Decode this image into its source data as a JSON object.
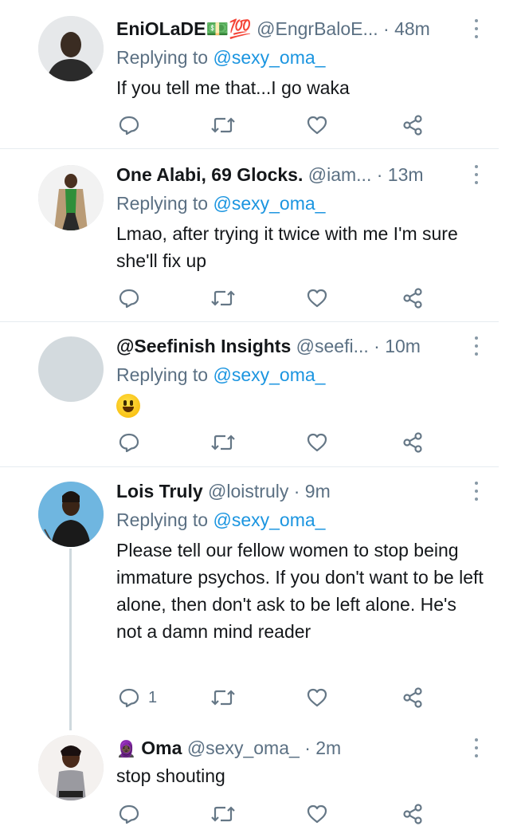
{
  "tweets": [
    {
      "name": "EniOLaDE💵💯",
      "handle": "@EngrBaloE...",
      "dot": "·",
      "time": "48m",
      "replying_prefix": "Replying to",
      "replying_to": "@sexy_oma_",
      "text": "If you tell me that...I go waka",
      "reply_count": ""
    },
    {
      "name": "One Alabi, 69 Glocks.",
      "handle": "@iam...",
      "dot": "·",
      "time": "13m",
      "replying_prefix": "Replying to",
      "replying_to": "@sexy_oma_",
      "text": "Lmao, after trying it twice with me I'm sure she'll fix up",
      "reply_count": ""
    },
    {
      "name": "@Seefinish Insights",
      "handle": "@seefi...",
      "dot": "·",
      "time": "10m",
      "replying_prefix": "Replying to",
      "replying_to": "@sexy_oma_",
      "text": "",
      "reply_count": ""
    },
    {
      "name": "Lois Truly",
      "handle": "@loistruly",
      "dot": "·",
      "time": "9m",
      "replying_prefix": "Replying to",
      "replying_to": "@sexy_oma_",
      "text": "Please tell our fellow women to stop being immature psychos. If you don't want to be left alone, then don't ask to be left alone. He's not a damn mind reader",
      "reply_count": "1"
    },
    {
      "name": "Oma",
      "handle": "@sexy_oma_",
      "dot": "·",
      "time": "2m",
      "text": "stop shouting",
      "reply_count": ""
    }
  ],
  "icons": [
    "reply-icon",
    "retweet-icon",
    "like-icon",
    "share-icon",
    "more-icon",
    "grinning-face-emoji",
    "user-emoji"
  ],
  "colors": {
    "link": "#1b95e0",
    "secondary": "#5b7083",
    "icon": "#657786",
    "divider": "#e6ecf0"
  }
}
